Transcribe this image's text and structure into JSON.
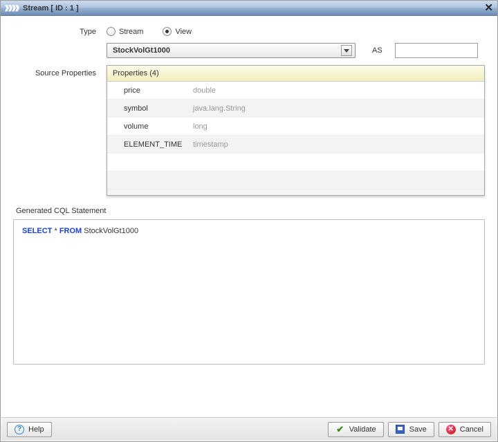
{
  "window": {
    "title": "Stream [ ID : 1 ]"
  },
  "form": {
    "type_label": "Type",
    "radios": {
      "stream": "Stream",
      "view": "View"
    },
    "selected_type": "view",
    "source_select": "StockVolGt1000",
    "as_label": "AS",
    "alias_value": ""
  },
  "source_properties": {
    "label": "Source Properties",
    "header": "Properties (4)",
    "rows": [
      {
        "name": "price",
        "type": "double"
      },
      {
        "name": "symbol",
        "type": "java.lang.String"
      },
      {
        "name": "volume",
        "type": "long"
      },
      {
        "name": "ELEMENT_TIME",
        "type": "timestamp"
      }
    ]
  },
  "generated": {
    "label": "Generated CQL Statement",
    "kw1": "SELECT",
    "star": " * ",
    "kw2": "FROM",
    "rest": " StockVolGt1000"
  },
  "footer": {
    "help": "Help",
    "validate": "Validate",
    "save": "Save",
    "cancel": "Cancel"
  }
}
